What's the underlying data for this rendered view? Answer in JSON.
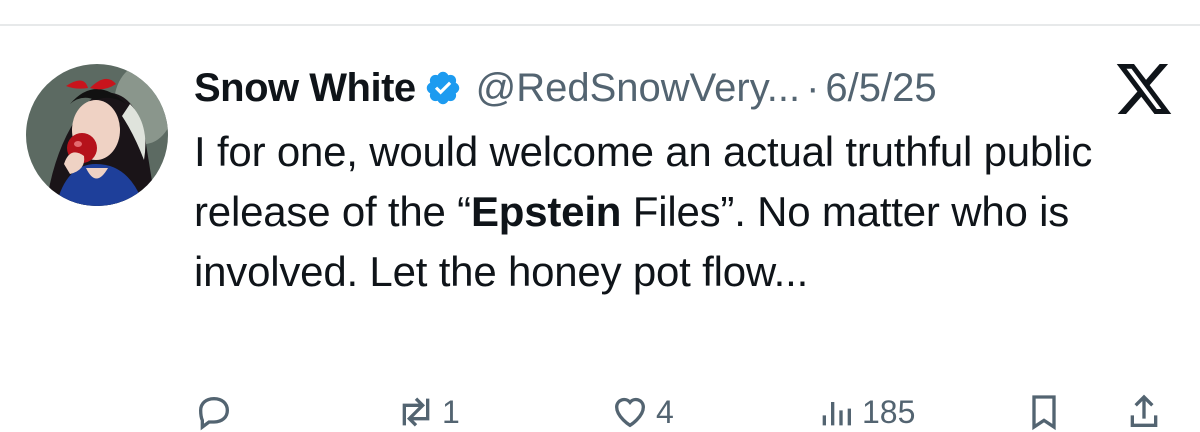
{
  "tweet": {
    "display_name": "Snow White",
    "handle": "@RedSnowVery...",
    "separator": "·",
    "date": "6/5/25",
    "text_parts": {
      "p1": "I for one, would welcome an actual truthful public release of the “",
      "bold": "Epstein",
      "p2": " Files”. No matter who is involved. Let the honey pot flow..."
    }
  },
  "actions": {
    "reply": {
      "icon": "reply-icon",
      "count": ""
    },
    "retweet": {
      "icon": "retweet-icon",
      "count": "1"
    },
    "like": {
      "icon": "heart-icon",
      "count": "4"
    },
    "views": {
      "icon": "views-icon",
      "count": "185"
    },
    "bookmark": {
      "icon": "bookmark-icon",
      "count": ""
    },
    "share": {
      "icon": "share-icon",
      "count": ""
    }
  },
  "colors": {
    "verified_badge": "#1d9bf0",
    "secondary_text": "#536471",
    "divider": "#e7e9ea"
  }
}
